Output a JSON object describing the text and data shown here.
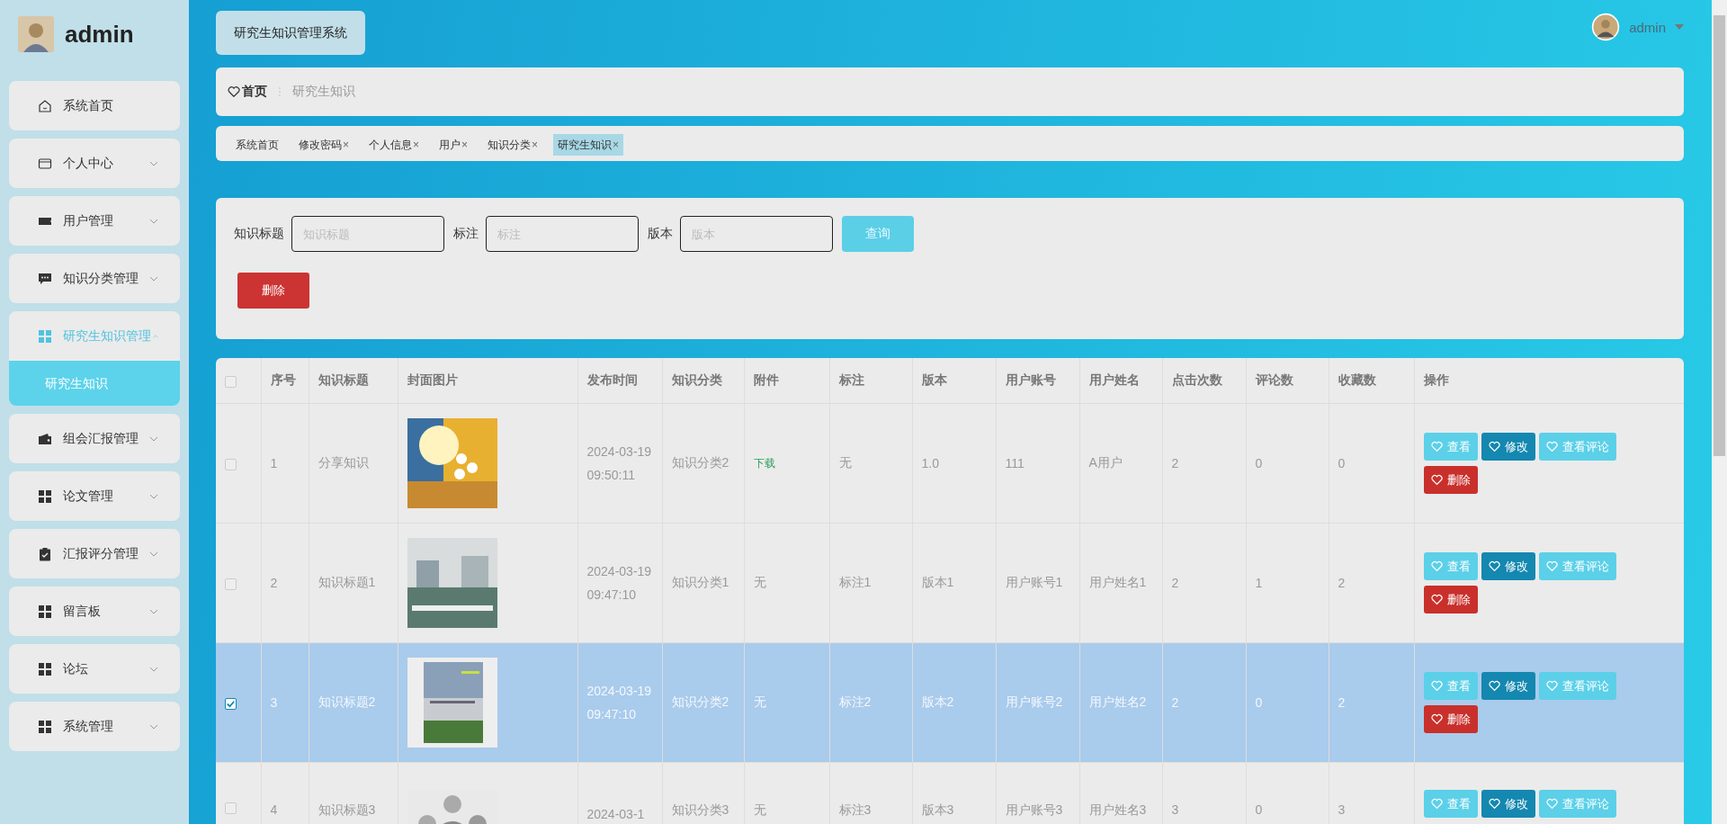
{
  "sidebar": {
    "user": "admin",
    "items": [
      {
        "label": "系统首页",
        "kind": "link",
        "expanded": false
      },
      {
        "label": "个人中心",
        "kind": "menu",
        "expanded": false
      },
      {
        "label": "用户管理",
        "kind": "menu",
        "expanded": false
      },
      {
        "label": "知识分类管理",
        "kind": "menu",
        "expanded": false
      },
      {
        "label": "研究生知识管理",
        "kind": "menu",
        "expanded": true,
        "children": [
          {
            "label": "研究生知识",
            "selected": true
          }
        ]
      },
      {
        "label": "组会汇报管理",
        "kind": "menu",
        "expanded": false
      },
      {
        "label": "论文管理",
        "kind": "menu",
        "expanded": false
      },
      {
        "label": "汇报评分管理",
        "kind": "menu",
        "expanded": false
      },
      {
        "label": "留言板",
        "kind": "menu",
        "expanded": false
      },
      {
        "label": "论坛",
        "kind": "menu",
        "expanded": false
      },
      {
        "label": "系统管理",
        "kind": "menu",
        "expanded": false
      }
    ]
  },
  "header": {
    "title": "研究生知识管理系统",
    "user": "admin"
  },
  "breadcrumb": {
    "home": "首页",
    "current": "研究生知识"
  },
  "tabs": [
    {
      "label": "系统首页",
      "selected": false
    },
    {
      "label": "修改密码",
      "close": "×",
      "selected": false
    },
    {
      "label": "个人信息",
      "close": "×",
      "selected": false
    },
    {
      "label": "用户",
      "close": "×",
      "selected": false
    },
    {
      "label": "知识分类",
      "close": "×",
      "selected": false
    },
    {
      "label": "研究生知识",
      "close": "×",
      "selected": true
    }
  ],
  "search": {
    "fields": [
      {
        "label": "知识标题",
        "placeholder": "知识标题"
      },
      {
        "label": "标注",
        "placeholder": "标注"
      },
      {
        "label": "版本",
        "placeholder": "版本"
      }
    ],
    "query_button": "查询",
    "delete_button": "删除"
  },
  "table": {
    "all_selected": false,
    "columns": [
      "序号",
      "知识标题",
      "封面图片",
      "发布时间",
      "知识分类",
      "附件",
      "标注",
      "版本",
      "用户账号",
      "用户姓名",
      "点击次数",
      "评论数",
      "收藏数",
      "操作"
    ],
    "rows": [
      {
        "selected": false,
        "index": "1",
        "title": "分享知识",
        "cover": {
          "kind": "picture"
        },
        "time": "2024-03-19 09:50:11",
        "category": "知识分类2",
        "attachment": {
          "text": "下载",
          "kind": "link"
        },
        "mark": "无",
        "version": "1.0",
        "account": "111",
        "name": "A用户",
        "clicks": "2",
        "comments": "0",
        "favorites": "0",
        "actions": [
          {
            "label": "查看",
            "kind": "view"
          },
          {
            "label": "修改",
            "kind": "edit"
          },
          {
            "label": "查看评论",
            "kind": "view"
          },
          {
            "label": "删除",
            "kind": "delete"
          }
        ]
      },
      {
        "selected": false,
        "index": "2",
        "title": "知识标题1",
        "cover": {
          "kind": "picture"
        },
        "time": "2024-03-19 09:47:10",
        "category": "知识分类1",
        "attachment": {
          "text": "无",
          "kind": "text"
        },
        "mark": "标注1",
        "version": "版本1",
        "account": "用户账号1",
        "name": "用户姓名1",
        "clicks": "2",
        "comments": "1",
        "favorites": "2",
        "actions": [
          {
            "label": "查看",
            "kind": "view"
          },
          {
            "label": "修改",
            "kind": "edit"
          },
          {
            "label": "查看评论",
            "kind": "view"
          },
          {
            "label": "删除",
            "kind": "delete"
          }
        ]
      },
      {
        "selected": true,
        "index": "3",
        "title": "知识标题2",
        "cover": {
          "kind": "picture"
        },
        "time": "2024-03-19 09:47:10",
        "category": "知识分类2",
        "attachment": {
          "text": "无",
          "kind": "text"
        },
        "mark": "标注2",
        "version": "版本2",
        "account": "用户账号2",
        "name": "用户姓名2",
        "clicks": "2",
        "comments": "0",
        "favorites": "2",
        "actions": [
          {
            "label": "查看",
            "kind": "view"
          },
          {
            "label": "修改",
            "kind": "edit"
          },
          {
            "label": "查看评论",
            "kind": "view"
          },
          {
            "label": "删除",
            "kind": "delete"
          }
        ]
      },
      {
        "selected": false,
        "index": "4",
        "title": "知识标题3",
        "cover": {
          "kind": "picture"
        },
        "time": "2024-03-1",
        "category": "知识分类3",
        "attachment": {
          "text": "无",
          "kind": "text"
        },
        "mark": "标注3",
        "version": "版本3",
        "account": "用户账号3",
        "name": "用户姓名3",
        "clicks": "3",
        "comments": "0",
        "favorites": "3",
        "actions": [
          {
            "label": "查看",
            "kind": "view"
          },
          {
            "label": "修改",
            "kind": "edit"
          },
          {
            "label": "查看评论",
            "kind": "view"
          }
        ]
      }
    ]
  }
}
